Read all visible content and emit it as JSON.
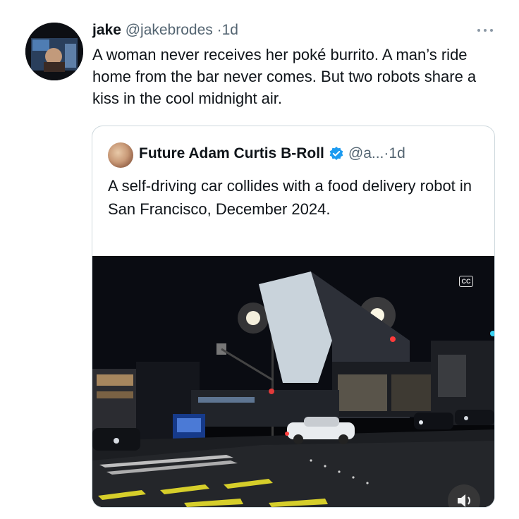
{
  "tweet": {
    "author_name": "jake",
    "author_handle": "@jakebrodes",
    "separator": "·",
    "time": "1d",
    "text": "A woman never receives her poké burrito. A man’s ride home from the bar never comes. But two robots share a kiss in the cool midnight air.",
    "more_icon": "more-horizontal-icon"
  },
  "quote": {
    "author_name": "Future Adam Curtis B-Roll",
    "verified_icon": "verified-badge-icon",
    "author_handle": "@a...",
    "separator": "·",
    "time": "1d",
    "text": "A self-driving car collides with a food delivery robot in San Francisco, December 2024.",
    "media": {
      "type": "video",
      "captions_label": "CC",
      "controls": [
        "captions-icon",
        "volume-icon"
      ]
    }
  },
  "colors": {
    "text_primary": "#0f1419",
    "text_secondary": "#536471",
    "verified_blue": "#1d9bf0",
    "border": "#cfd9de"
  }
}
